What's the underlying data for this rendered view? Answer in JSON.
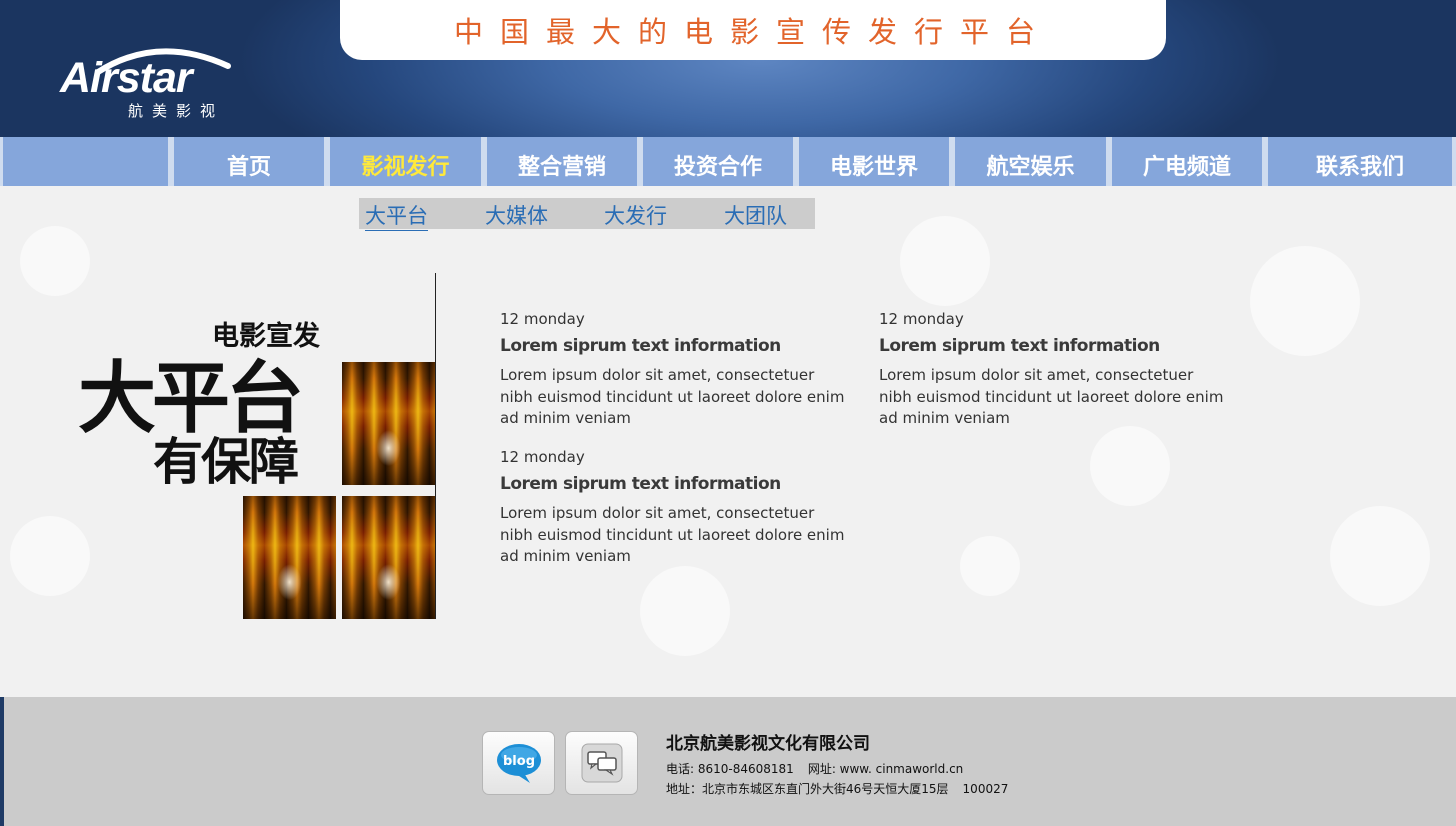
{
  "header": {
    "slogan": "中国最大的电影宣传发行平台",
    "logo": {
      "brand": "Airstar",
      "subtitle": "航美影视"
    }
  },
  "nav": {
    "items": [
      {
        "label": ""
      },
      {
        "label": "首页"
      },
      {
        "label": "影视发行",
        "active": true
      },
      {
        "label": "整合营销"
      },
      {
        "label": "投资合作"
      },
      {
        "label": "电影世界"
      },
      {
        "label": "航空娱乐"
      },
      {
        "label": "广电频道"
      },
      {
        "label": "联系我们"
      }
    ],
    "active_color": "#ffe93a"
  },
  "subnav": {
    "items": [
      {
        "label": "大平台",
        "active": true
      },
      {
        "label": "大媒体"
      },
      {
        "label": "大发行"
      },
      {
        "label": "大团队"
      }
    ]
  },
  "promo": {
    "small": "电影宣发",
    "big": "大平台",
    "sub": "有保障"
  },
  "news": [
    {
      "date": "12 monday",
      "title": "Lorem siprum text information",
      "body": "Lorem ipsum dolor sit amet, consectetuer nibh euismod tincidunt ut laoreet dolore enim ad minim veniam"
    },
    {
      "date": "12 monday",
      "title": "Lorem siprum text information",
      "body": "Lorem ipsum dolor sit amet, consectetuer nibh euismod tincidunt ut laoreet dolore enim ad minim veniam"
    },
    {
      "date": "12 monday",
      "title": "Lorem siprum text information",
      "body": "Lorem ipsum dolor sit amet, consectetuer nibh euismod tincidunt ut laoreet dolore enim ad minim veniam"
    }
  ],
  "footer": {
    "blog_label": "blog",
    "company": "北京航美影视文化有限公司",
    "phone": "电话: 8610-84608181",
    "website": "网址: www. cinmaworld.cn",
    "address": "地址：北京市东城区东直门外大街46号天恒大厦15层",
    "postcode": "100027"
  },
  "colors": {
    "header_blue": "#25477d",
    "nav_blue": "#85a6db",
    "slogan_orange": "#e2642b",
    "subnav_link": "#2a6db5"
  }
}
